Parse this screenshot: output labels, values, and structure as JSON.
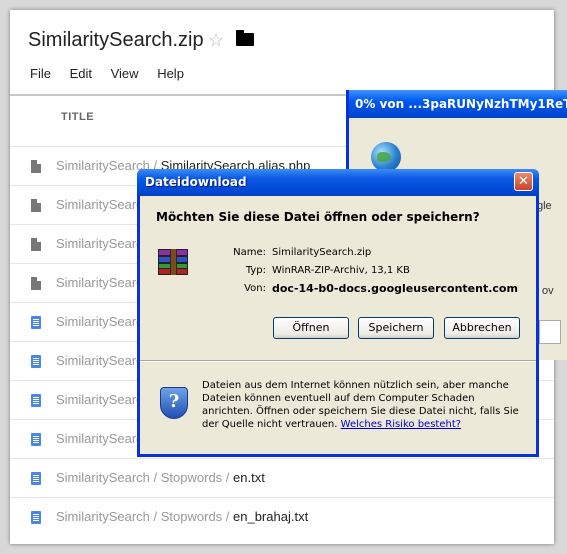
{
  "viewer": {
    "title": "SimilaritySearch.zip",
    "star_icon": "star-icon",
    "folder_icon": "folder-icon",
    "menu": [
      "File",
      "Edit",
      "View",
      "Help"
    ],
    "column_title": "TITLE",
    "rows": [
      {
        "icon": "file-icon",
        "path": "SimilaritySearch",
        "sep": " / ",
        "name": "SimilaritySearch.alias.php"
      },
      {
        "icon": "file-icon",
        "path": "SimilaritySearch",
        "sep": "",
        "name": ""
      },
      {
        "icon": "file-icon",
        "path": "SimilaritySearch",
        "sep": "",
        "name": ""
      },
      {
        "icon": "file-icon",
        "path": "SimilaritySearch",
        "sep": "",
        "name": ""
      },
      {
        "icon": "doc-icon",
        "path": "SimilaritySearch",
        "sep": "",
        "name": ""
      },
      {
        "icon": "doc-icon",
        "path": "SimilaritySearch",
        "sep": "",
        "name": ""
      },
      {
        "icon": "doc-icon",
        "path": "SimilaritySearch",
        "sep": "",
        "name": ""
      },
      {
        "icon": "doc-icon",
        "path": "SimilaritySearch",
        "sep": "",
        "name": ""
      },
      {
        "icon": "doc-icon",
        "path": "SimilaritySearch / Stopwords",
        "sep": " / ",
        "name": "en.txt"
      },
      {
        "icon": "doc-icon",
        "path": "SimilaritySearch / Stopwords",
        "sep": " / ",
        "name": "en_brahaj.txt"
      }
    ]
  },
  "progress_window": {
    "title": "0% von ...3paRUNyNzhTMy1ReT",
    "globe_icon": "globe-icon",
    "edge_text_1": "gle",
    "edge_text_2": "ov"
  },
  "dialog": {
    "title": "Dateidownload",
    "question": "Möchten Sie diese Datei öffnen oder speichern?",
    "name_label": "Name:",
    "name_value": "SimilaritySearch.zip",
    "type_label": "Typ:",
    "type_value": "WinRAR-ZIP-Archiv, 13,1 KB",
    "from_label": "Von:",
    "from_value": "doc-14-b0-docs.googleusercontent.com",
    "btn_open": "Öffnen",
    "btn_save": "Speichern",
    "btn_cancel": "Abbrechen",
    "warning": "Dateien aus dem Internet können nützlich sein, aber manche Dateien können eventuell auf dem Computer Schaden anrichten. Öffnen oder speichern Sie diese Datei nicht, falls Sie der Quelle nicht vertrauen.",
    "risk_link": "Welches Risiko besteht?"
  }
}
